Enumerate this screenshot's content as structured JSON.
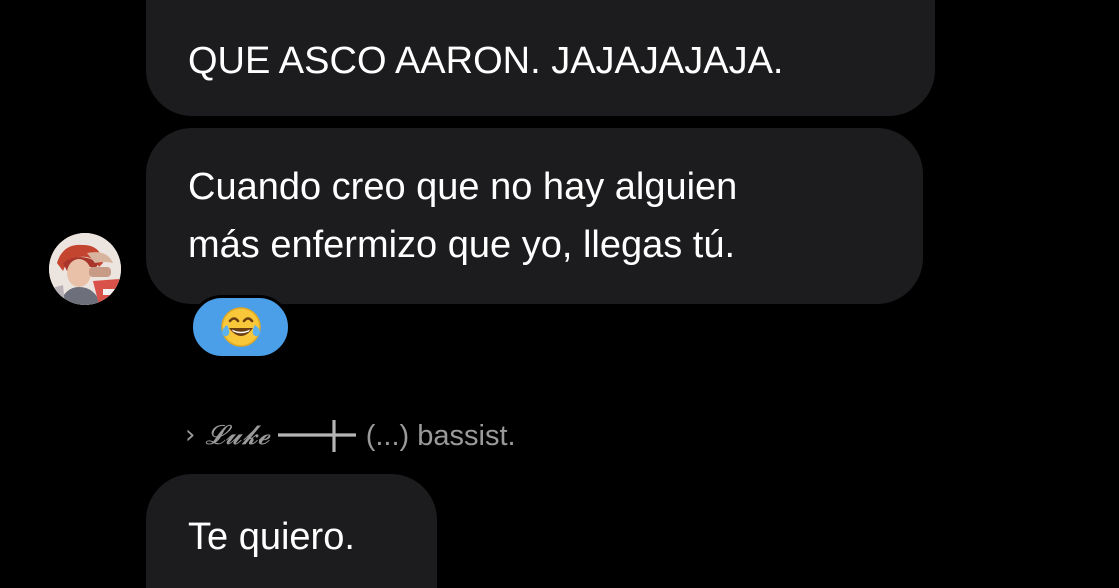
{
  "messages": [
    {
      "text": "QUE ASCO AARON. JAJAJAJAJA."
    },
    {
      "lines": [
        "Cuando creo que no hay alguien",
        "más enfermizo que yo, llegas tú."
      ]
    },
    {
      "text": "Te quiero."
    }
  ],
  "reaction": {
    "emoji": "😂",
    "icon": "face-with-tears-of-joy-icon",
    "background": "#4b9ee8"
  },
  "signature": {
    "chevron": "›",
    "name": "𝓛𝓾𝓴𝓮",
    "tagline": "(...) bassist."
  },
  "colors": {
    "background": "#000000",
    "bubble": "#1c1c1e",
    "text": "#ffffff",
    "muted_text": "#9a9a9a"
  }
}
